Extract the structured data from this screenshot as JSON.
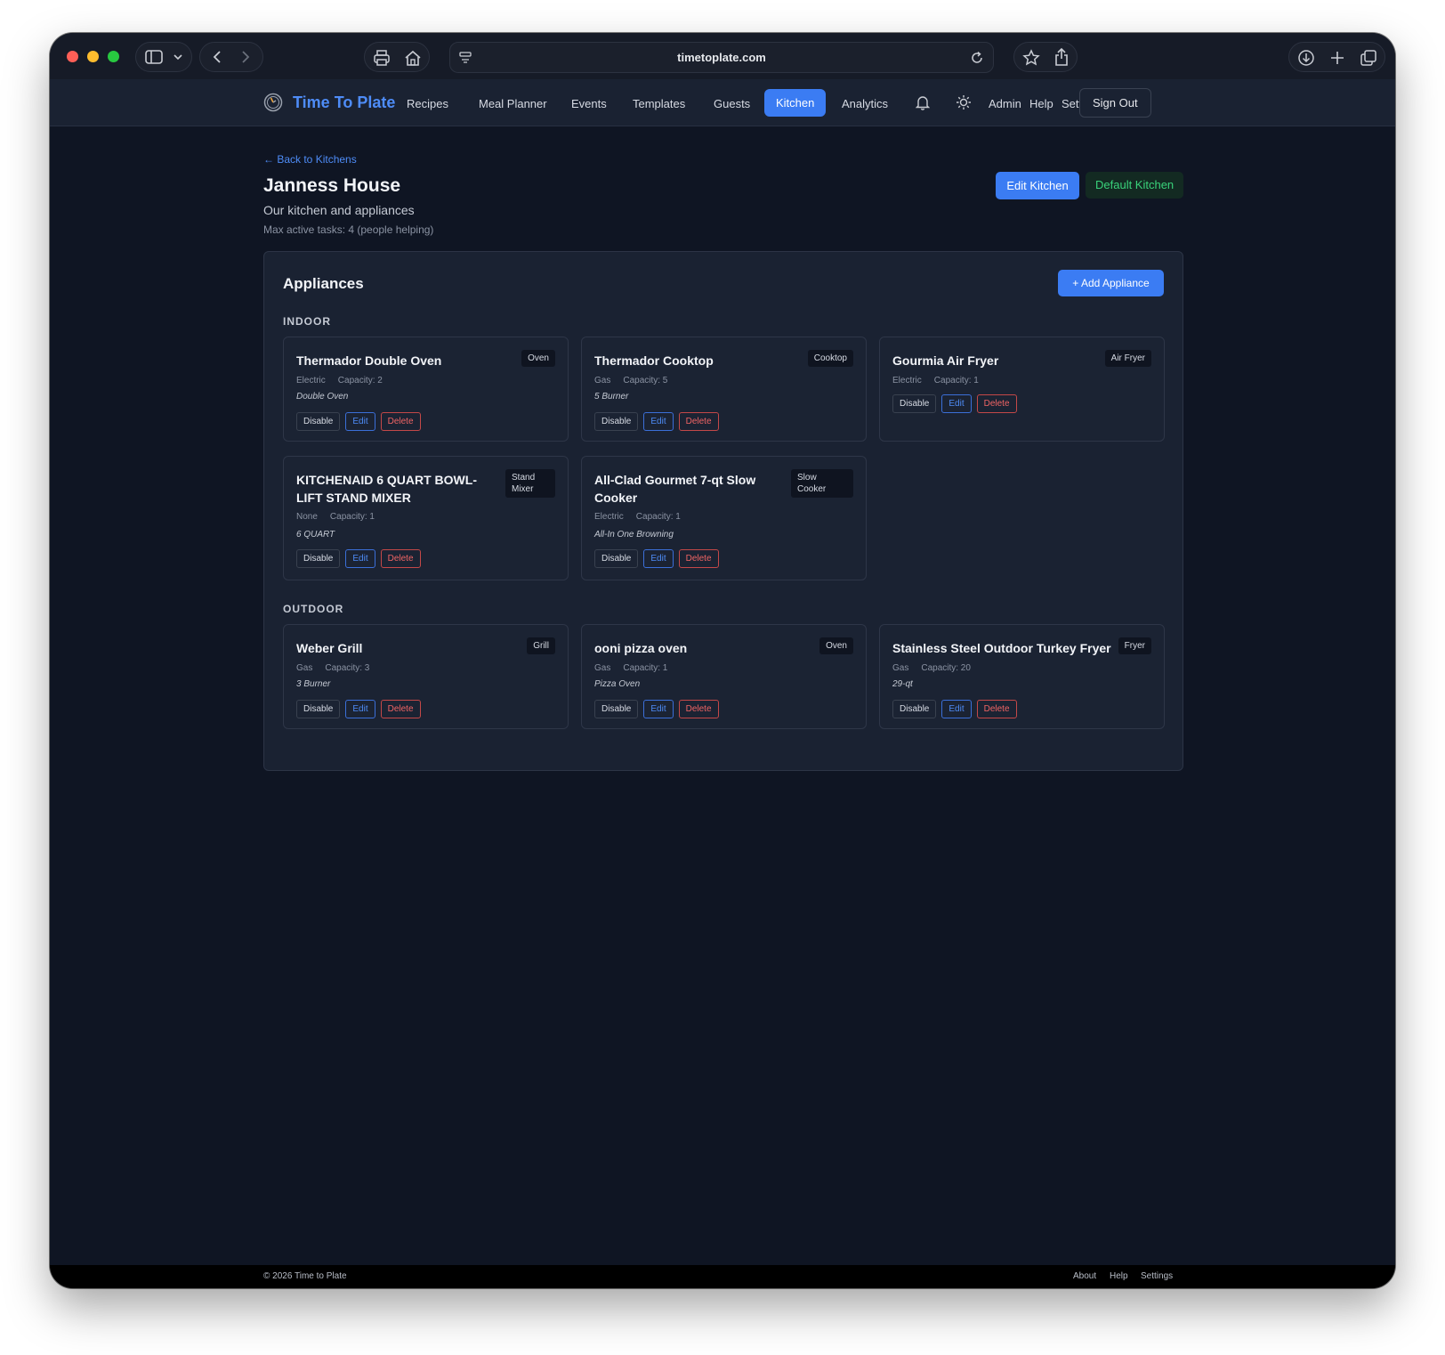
{
  "browser": {
    "url": "timetoplate.com"
  },
  "nav": {
    "brand": "Time To Plate",
    "links": [
      "Recipes",
      "Meal Planner",
      "Events",
      "Templates",
      "Guests",
      "Kitchen",
      "Analytics"
    ],
    "active": "Kitchen",
    "admin": "Admin",
    "help": "Help",
    "settings": "Settings",
    "sign_out": "Sign Out"
  },
  "page": {
    "back_link": "← Back to Kitchens",
    "title": "Janness House",
    "subtitle": "Our kitchen and appliances",
    "meta": "Max active tasks: 4 (people helping)",
    "edit_button": "Edit Kitchen",
    "default_badge": "Default Kitchen"
  },
  "appliances": {
    "title": "Appliances",
    "add_button": "+ Add Appliance",
    "action_disable": "Disable",
    "action_edit": "Edit",
    "action_delete": "Delete",
    "groups": [
      {
        "label": "INDOOR",
        "items": [
          {
            "name": "Thermador Double Oven",
            "tag": "Oven",
            "power": "Electric",
            "capacity": "Capacity: 2",
            "note": "Double Oven"
          },
          {
            "name": "Thermador Cooktop",
            "tag": "Cooktop",
            "power": "Gas",
            "capacity": "Capacity: 5",
            "note": "5 Burner"
          },
          {
            "name": "Gourmia Air Fryer",
            "tag": "Air Fryer",
            "power": "Electric",
            "capacity": "Capacity: 1",
            "note": ""
          },
          {
            "name": "KITCHENAID 6 QUART BOWL-LIFT STAND MIXER",
            "tag": "Stand Mixer",
            "power": "None",
            "capacity": "Capacity: 1",
            "note": "6 QUART"
          },
          {
            "name": "All-Clad Gourmet 7-qt Slow Cooker",
            "tag": "Slow Cooker",
            "power": "Electric",
            "capacity": "Capacity: 1",
            "note": "All-In One Browning"
          }
        ]
      },
      {
        "label": "OUTDOOR",
        "items": [
          {
            "name": "Weber Grill",
            "tag": "Grill",
            "power": "Gas",
            "capacity": "Capacity: 3",
            "note": "3 Burner"
          },
          {
            "name": "ooni pizza oven",
            "tag": "Oven",
            "power": "Gas",
            "capacity": "Capacity: 1",
            "note": "Pizza Oven"
          },
          {
            "name": "Stainless Steel Outdoor Turkey Fryer",
            "tag": "Fryer",
            "power": "Gas",
            "capacity": "Capacity: 20",
            "note": "29-qt"
          }
        ]
      }
    ]
  },
  "footer": {
    "copyright": "© 2026 Time to Plate",
    "about": "About",
    "help": "Help",
    "settings": "Settings"
  }
}
